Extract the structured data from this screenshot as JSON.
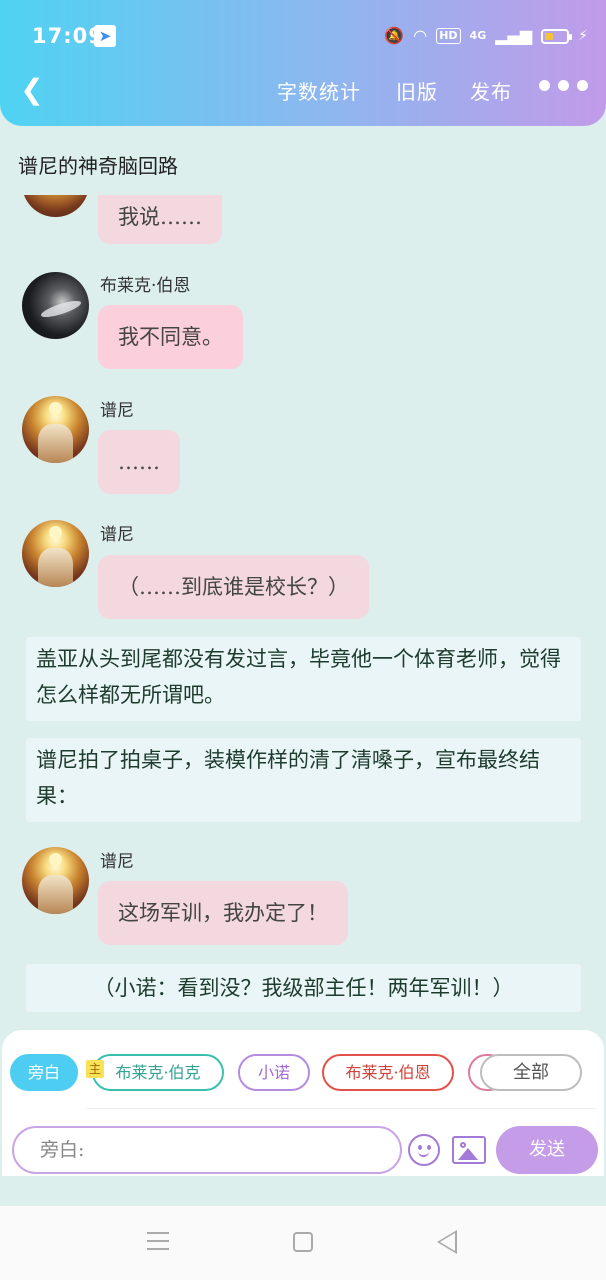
{
  "status_bar": {
    "time": "17:09",
    "network": "4G",
    "hd_label": "HD"
  },
  "header": {
    "back_icon": "chevron-left-icon",
    "nav": {
      "word_count": "字数统计",
      "old_version": "旧版",
      "publish": "发布"
    },
    "more_icon": "more-dots-icon"
  },
  "page_title": "谱尼的神奇脑回路",
  "messages": [
    {
      "type": "bubble",
      "speaker": "",
      "text": "我说……"
    },
    {
      "type": "bubble",
      "speaker": "布莱克·伯恩",
      "text": "我不同意。"
    },
    {
      "type": "bubble",
      "speaker": "谱尼",
      "text": "……"
    },
    {
      "type": "bubble",
      "speaker": "谱尼",
      "text": "（……到底谁是校长？）"
    },
    {
      "type": "narration",
      "text": "盖亚从头到尾都没有发过言，毕竟他一个体育老师，觉得怎么样都无所谓吧。"
    },
    {
      "type": "narration",
      "text": "谱尼拍了拍桌子，装模作样的清了清嗓子，宣布最终结果："
    },
    {
      "type": "bubble",
      "speaker": "谱尼",
      "text": "这场军训，我办定了！"
    },
    {
      "type": "narration",
      "text": "（小诺：看到没？我级部主任！两年军训！）"
    }
  ],
  "roles": {
    "narrator": "旁白",
    "main_badge": "主",
    "blake_main": "布莱克·伯克",
    "xiaonuo": "小诺",
    "blake": "布莱克·伯恩",
    "all": "全部"
  },
  "composer": {
    "placeholder": "旁白:",
    "send_label": "发送",
    "emoji_icon": "emoji-icon",
    "image_icon": "image-icon"
  },
  "colors": {
    "header_gradient_start": "#4fd3f2",
    "header_gradient_end": "#c19be9",
    "page_bg": "#dcefed",
    "bubble_bg": "#f3d8df",
    "send_button": "#c59ce8"
  }
}
